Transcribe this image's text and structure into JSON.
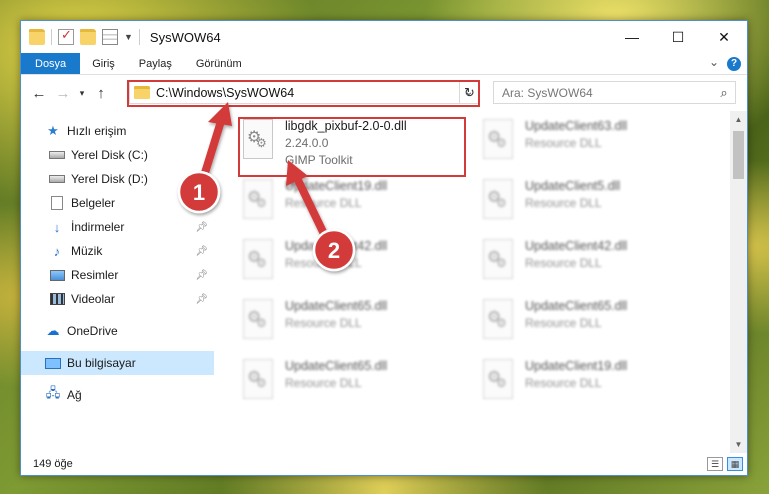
{
  "window": {
    "title": "SysWOW64",
    "controls": {
      "minimize": "—",
      "maximize": "☐",
      "close": "✕"
    }
  },
  "ribbon": {
    "tabs": [
      {
        "label": "Dosya",
        "active": true
      },
      {
        "label": "Giriş"
      },
      {
        "label": "Paylaş"
      },
      {
        "label": "Görünüm"
      }
    ],
    "help": "?"
  },
  "address": {
    "path": "C:\\Windows\\SysWOW64",
    "search_placeholder": "Ara: SysWOW64"
  },
  "sidebar": {
    "items": [
      {
        "label": "Hızlı erişim",
        "icon": "star-icon"
      },
      {
        "label": "Yerel Disk (C:)",
        "icon": "drive-icon"
      },
      {
        "label": "Yerel Disk (D:)",
        "icon": "drive-icon"
      },
      {
        "label": "Belgeler",
        "icon": "document-icon"
      },
      {
        "label": "İndirmeler",
        "icon": "download-icon",
        "pinned": true
      },
      {
        "label": "Müzik",
        "icon": "music-icon",
        "pinned": true
      },
      {
        "label": "Resimler",
        "icon": "pictures-icon",
        "pinned": true
      },
      {
        "label": "Videolar",
        "icon": "video-icon",
        "pinned": true
      },
      {
        "label": "OneDrive",
        "icon": "cloud-icon"
      },
      {
        "label": "Bu bilgisayar",
        "icon": "computer-icon",
        "selected": true
      },
      {
        "label": "Ağ",
        "icon": "network-icon"
      }
    ]
  },
  "files": {
    "highlighted": {
      "name": "libgdk_pixbuf-2.0-0.dll",
      "version": "2.24.0.0",
      "company": "GIMP Toolkit"
    },
    "left_column": [
      {
        "name": "UpdateClient19.dll",
        "type": "Resource DLL"
      },
      {
        "name": "UpdateClient42.dll",
        "type": "Resource DLL"
      },
      {
        "name": "UpdateClient65.dll",
        "type": "Resource DLL"
      },
      {
        "name": "UpdateClient65.dll",
        "type": "Resource DLL"
      }
    ],
    "right_column": [
      {
        "name": "UpdateClient63.dll",
        "type": "Resource DLL"
      },
      {
        "name": "UpdateClient5.dll",
        "type": "Resource DLL"
      },
      {
        "name": "UpdateClient42.dll",
        "type": "Resource DLL"
      },
      {
        "name": "UpdateClient65.dll",
        "type": "Resource DLL"
      },
      {
        "name": "UpdateClient19.dll",
        "type": "Resource DLL"
      }
    ]
  },
  "status": {
    "count": "149 öğe"
  },
  "annotations": {
    "badge_1": "1",
    "badge_2": "2",
    "color": "#d33b3b"
  }
}
